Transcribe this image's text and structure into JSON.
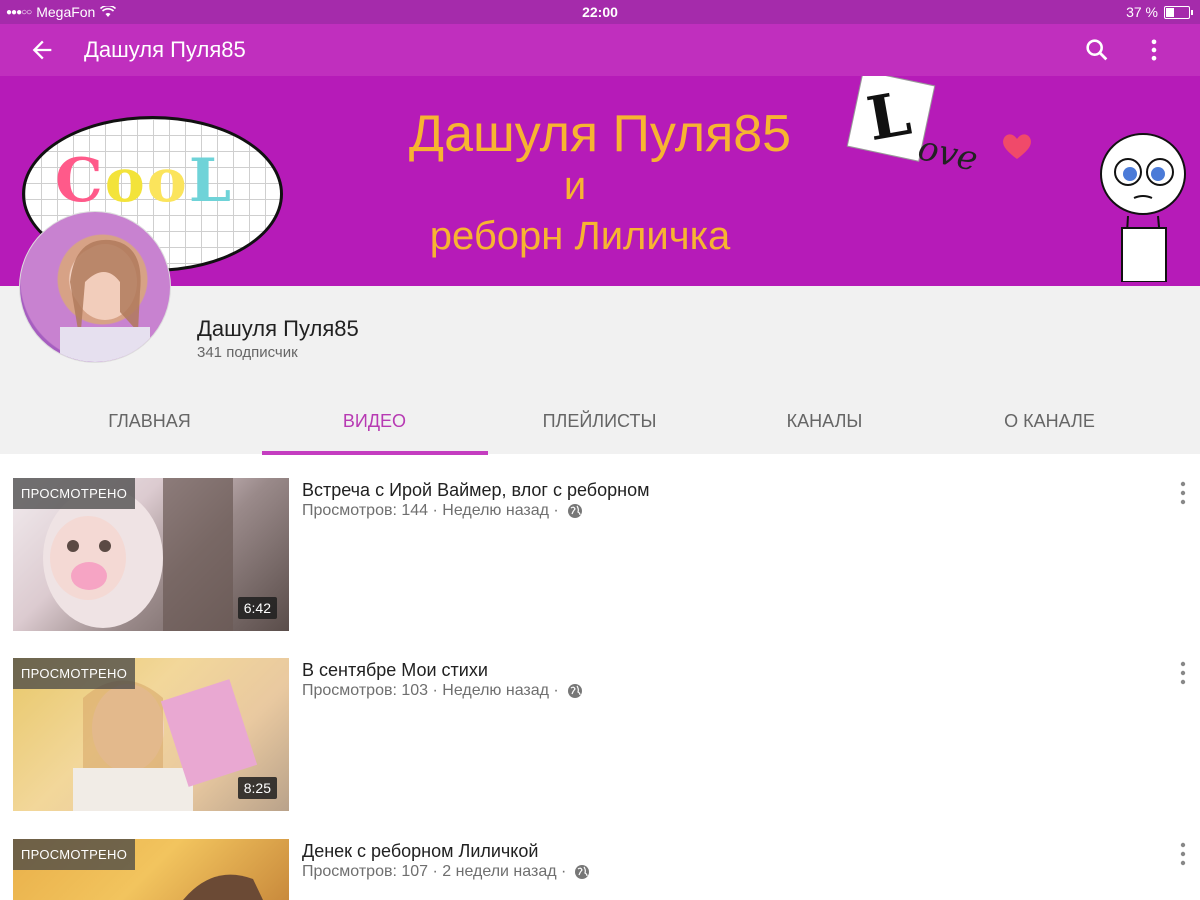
{
  "status_bar": {
    "carrier": "MegaFon",
    "signal_dots": "●●●○○",
    "time": "22:00",
    "battery_percent": "37 %",
    "battery_level": 0.37
  },
  "app_bar": {
    "title": "Дашуля Пуля85",
    "back_icon": "arrow-back-icon",
    "search_icon": "search-icon",
    "more_icon": "more-vertical-icon"
  },
  "banner": {
    "cool_text": [
      "C",
      "o",
      "o",
      "L"
    ],
    "line1": "Дашуля Пуля85",
    "line2": "и",
    "line3": "реборн Лиличка",
    "love_letter": "L",
    "love_rest": "ove"
  },
  "channel": {
    "name": "Дашуля Пуля85",
    "subscribers": "341 подписчик"
  },
  "tabs": [
    {
      "label": "ГЛАВНАЯ",
      "active": false
    },
    {
      "label": "ВИДЕО",
      "active": true
    },
    {
      "label": "ПЛЕЙЛИСТЫ",
      "active": false
    },
    {
      "label": "КАНАЛЫ",
      "active": false
    },
    {
      "label": "О КАНАЛЕ",
      "active": false
    }
  ],
  "videos": [
    {
      "title": "Встреча с Ирой Ваймер, влог с реборном",
      "meta": "Просмотров: 144 · Неделю назад ·",
      "watched": "ПРОСМОТРЕНО",
      "duration": "6:42"
    },
    {
      "title": "В сентябре Мои стихи",
      "meta": "Просмотров: 103 · Неделю назад ·",
      "watched": "ПРОСМОТРЕНО",
      "duration": "8:25"
    },
    {
      "title": "Денек с реборном Лиличкой",
      "meta": "Просмотров: 107 · 2 недели назад ·",
      "watched": "ПРОСМОТРЕНО",
      "duration": ""
    }
  ],
  "colors": {
    "app_bar": "#c02fbe",
    "status_bar": "#a52bab",
    "accent": "#c43dc0",
    "banner_text": "#f7b431"
  }
}
